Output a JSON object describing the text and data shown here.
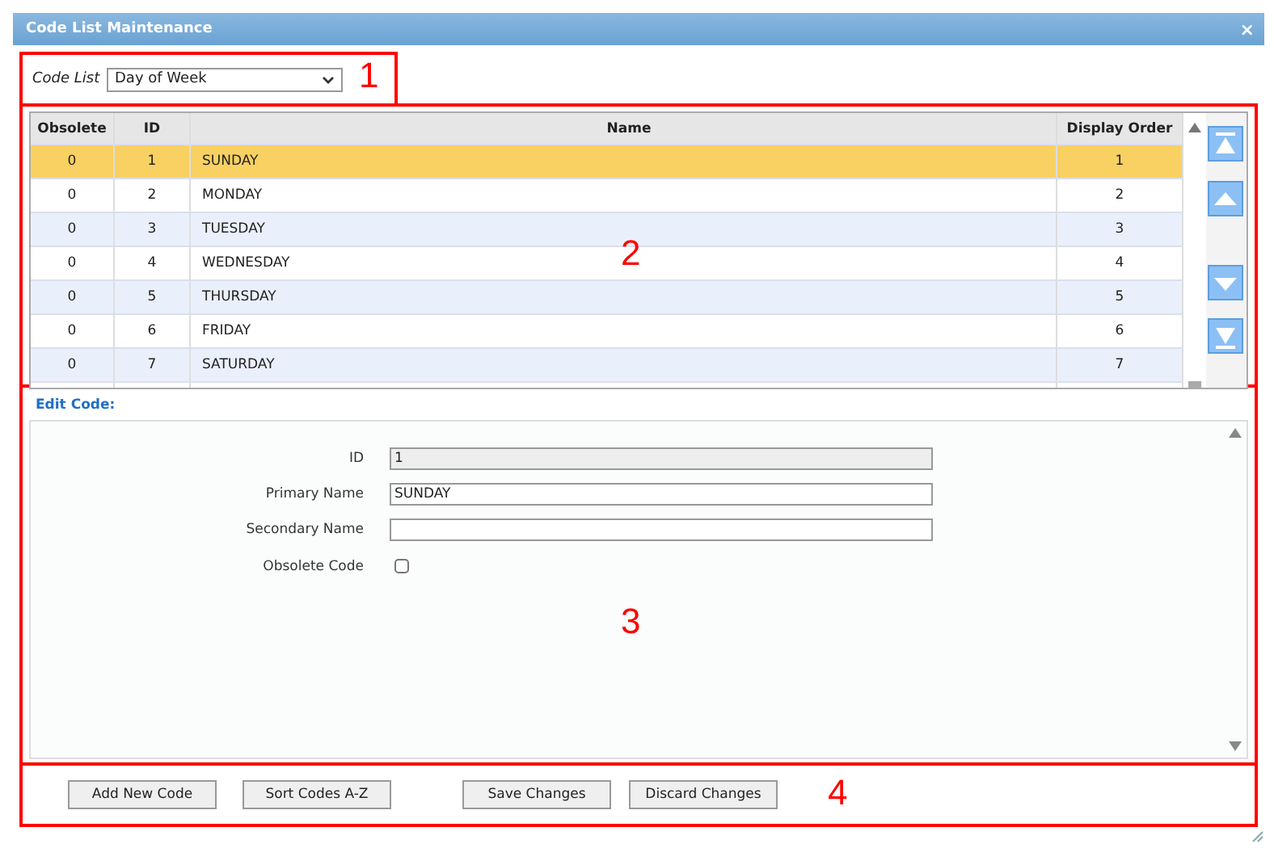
{
  "window": {
    "title": "Code List Maintenance",
    "close": "×"
  },
  "code_list": {
    "label": "Code List",
    "value": "Day of Week"
  },
  "grid": {
    "columns": [
      "Obsolete",
      "ID",
      "Name",
      "Display Order"
    ],
    "rows": [
      {
        "cells": [
          "0",
          "1",
          "SUNDAY",
          "1"
        ],
        "selected": true
      },
      {
        "cells": [
          "0",
          "2",
          "MONDAY",
          "2"
        ],
        "selected": false
      },
      {
        "cells": [
          "0",
          "3",
          "TUESDAY",
          "3"
        ],
        "selected": false
      },
      {
        "cells": [
          "0",
          "4",
          "WEDNESDAY",
          "4"
        ],
        "selected": false
      },
      {
        "cells": [
          "0",
          "5",
          "THURSDAY",
          "5"
        ],
        "selected": false
      },
      {
        "cells": [
          "0",
          "6",
          "FRIDAY",
          "6"
        ],
        "selected": false
      },
      {
        "cells": [
          "0",
          "7",
          "SATURDAY",
          "7"
        ],
        "selected": false
      }
    ]
  },
  "edit_code": {
    "title": "Edit Code:",
    "fields": [
      {
        "kind": "text",
        "label": "ID",
        "value": "1",
        "disabled": true
      },
      {
        "kind": "text",
        "label": "Primary Name",
        "value": "SUNDAY",
        "disabled": false
      },
      {
        "kind": "text",
        "label": "Secondary Name",
        "disabled": false
      },
      {
        "kind": "checkbox",
        "label": "Obsolete Code",
        "checked": false
      }
    ]
  },
  "buttons": [
    "Add New Code",
    "Sort Codes A-Z",
    "Save Changes",
    "Discard Changes"
  ],
  "annotations": [
    {
      "label": "1"
    },
    {
      "label": "2"
    },
    {
      "label": "3"
    },
    {
      "label": "4"
    }
  ]
}
